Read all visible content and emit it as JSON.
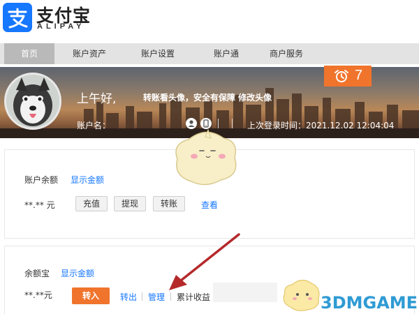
{
  "brand": {
    "name_cn": "支付宝",
    "name_en": "ALIPAY",
    "color": "#1677ff"
  },
  "nav": {
    "items": [
      {
        "label": "首页",
        "active": true
      },
      {
        "label": "账户资产",
        "active": false
      },
      {
        "label": "账户设置",
        "active": false
      },
      {
        "label": "账户通",
        "active": false
      },
      {
        "label": "商户服务",
        "active": false
      }
    ]
  },
  "banner": {
    "greeting": "上午好,",
    "tip": "转账看头像，安全有保障 修改头像",
    "account_label": "账户名：",
    "last_login": "上次登录时间：2021.12.02 12:04:04",
    "alarm_icon": "alarm-clock-icon",
    "alarm_count": "7",
    "accent": "#f0742c"
  },
  "balance": {
    "label": "账户余额",
    "show_amount": "显示金额",
    "amount": "**.** 元",
    "buttons": [
      "充值",
      "提现",
      "转账"
    ],
    "view_link": "查看"
  },
  "yuebao": {
    "label": "余额宝",
    "show_amount": "显示金额",
    "amount": "**.**元",
    "transfer_in": "转入",
    "links": [
      "转出",
      "管理",
      "累计收益"
    ]
  },
  "annotation": {
    "arrow_color": "#b5292b"
  },
  "watermark": {
    "text": "3DMGAME"
  }
}
